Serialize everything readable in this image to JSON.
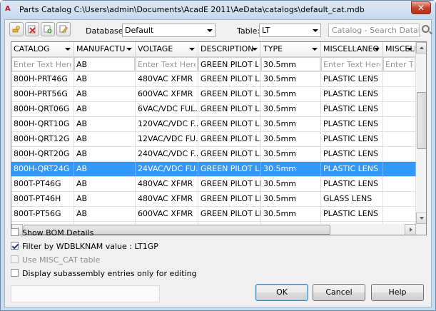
{
  "window": {
    "title": "Parts Catalog C:\\Users\\admin\\Documents\\AcadE 2011\\AeData\\catalogs\\default_cat.mdb",
    "app_icon": "autocad-electrical-icon",
    "close_glyph": "✕"
  },
  "toolbar": {
    "database_label": "Database:",
    "database_value": "Default",
    "table_label": "Table:",
    "table_value": "LT",
    "search_placeholder": "Catalog - Search Database"
  },
  "grid": {
    "columns": [
      "CATALOG",
      "MANUFACTU",
      "VOLTAGE",
      "DESCRIPTION",
      "TYPE",
      "MISCELLANEO",
      "MISCELLA"
    ],
    "filter_placeholder": "Enter Text Here",
    "filters": [
      "",
      "AB",
      "",
      "GREEN PILOT L...",
      "30.5mm",
      "",
      ""
    ],
    "selected_row": 6,
    "rows": [
      [
        "800H-PRT46G",
        "AB",
        "480VAC XFMR",
        "GREEN PILOT L...",
        "30.5mm",
        "PLASTIC LENS",
        ""
      ],
      [
        "800H-PRT56G",
        "AB",
        "600VAC XFMR",
        "GREEN PILOT L...",
        "30.5mm",
        "PLASTIC LENS",
        ""
      ],
      [
        "800H-QRT06G",
        "AB",
        "6VAC/VDC FUL...",
        "GREEN PILOT L...",
        "30.5mm",
        "PLASTIC LENS",
        ""
      ],
      [
        "800H-QRT10G",
        "AB",
        "120VAC/VDC F...",
        "GREEN PILOT L...",
        "30.5mm",
        "PLASTIC LENS",
        ""
      ],
      [
        "800H-QRT12G",
        "AB",
        "12VAC/VDC FU...",
        "GREEN PILOT L...",
        "30.5mm",
        "PLASTIC LENS",
        ""
      ],
      [
        "800H-QRT20G",
        "AB",
        "240VAC/VDC F...",
        "GREEN PILOT L...",
        "30.5mm",
        "PLASTIC LENS",
        ""
      ],
      [
        "800H-QRT24G",
        "AB",
        "24VAC/VDC FU...",
        "GREEN PILOT L...",
        "30.5mm",
        "PLASTIC LENS",
        ""
      ],
      [
        "800T-PT46G",
        "AB",
        "480VAC XFMR",
        "GREEN PILOT LI...",
        "30.5mm",
        "PLASTIC LENS",
        ""
      ],
      [
        "800T-PT46H",
        "AB",
        "480VAC XFMR",
        "GREEN PILOT LI...",
        "30.5mm",
        "GLASS LENS",
        ""
      ],
      [
        "800T-PT56G",
        "AB",
        "600VAC XFMR",
        "GREEN PILOT LI...",
        "30.5mm",
        "PLASTIC LENS",
        ""
      ],
      [
        "",
        "",
        "",
        "",
        "",
        "",
        ""
      ]
    ]
  },
  "options": {
    "show_bom": {
      "label": "Show BOM Details",
      "checked": false
    },
    "filter_wdblknam": {
      "label": "Filter by WDBLKNAM value : LT1GP",
      "checked": true
    },
    "use_misc_cat": {
      "label": "Use MISC_CAT table",
      "checked": false,
      "disabled": true
    },
    "display_subassembly": {
      "label": "Display subassembly entries only for editing",
      "checked": false
    }
  },
  "buttons": {
    "ok": "OK",
    "cancel": "Cancel",
    "help": "Help"
  },
  "colors": {
    "selection": "#3399ff",
    "window_frame": "#c9dcef"
  }
}
